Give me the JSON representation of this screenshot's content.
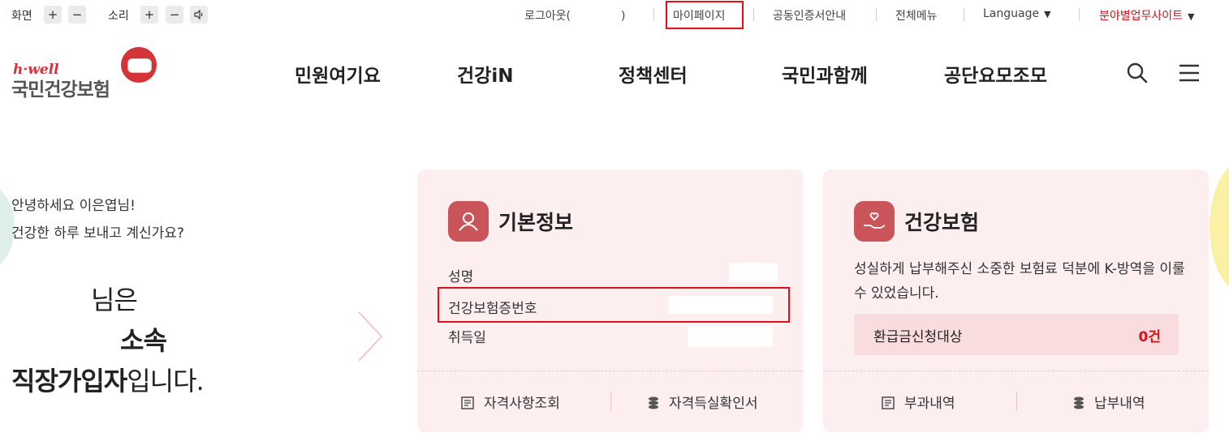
{
  "utility": {
    "screen_label": "화면",
    "sound_label": "소리",
    "plus": "+",
    "minus": "−",
    "logout": "로그아웃(",
    "logout_close": ")",
    "mypage": "마이페이지",
    "cert": "공동인증서안내",
    "allmenu": "전체메뉴",
    "language": "Language",
    "sites": "분야별업무사이트",
    "sites_color": "#c8161d"
  },
  "logo": {
    "tagline": "h·well",
    "name": "국민건강보험"
  },
  "nav": [
    "민원여기요",
    "건강iN",
    "정책센터",
    "국민과함께",
    "공단요모조모"
  ],
  "header_icons": [
    "search-icon",
    "menu-icon"
  ],
  "greeting": {
    "line1": "안녕하세요 이은엽님!",
    "line2": "건강한 하루 보내고 계신가요?",
    "status1": "님은",
    "status2": "소속",
    "status3_bold": "직장가입자",
    "status3_rest": "입니다."
  },
  "basic_info": {
    "title": "기본정보",
    "rows": [
      "성명",
      "건강보험증번호",
      "취득일"
    ],
    "footer": [
      "자격사항조회",
      "자격득실확인서"
    ]
  },
  "health_insurance": {
    "title": "건강보험",
    "description": "성실하게 납부해주신 소중한 보험료 덕분에 K-방역을 이룰 수 있었습니다.",
    "refund_label": "환급금신청대상",
    "refund_value": "0건",
    "footer": [
      "부과내역",
      "납부내역"
    ]
  },
  "colors": {
    "accent": "#c9545a",
    "card_bg": "#fdeff0",
    "highlight_box": "#e10f19"
  }
}
